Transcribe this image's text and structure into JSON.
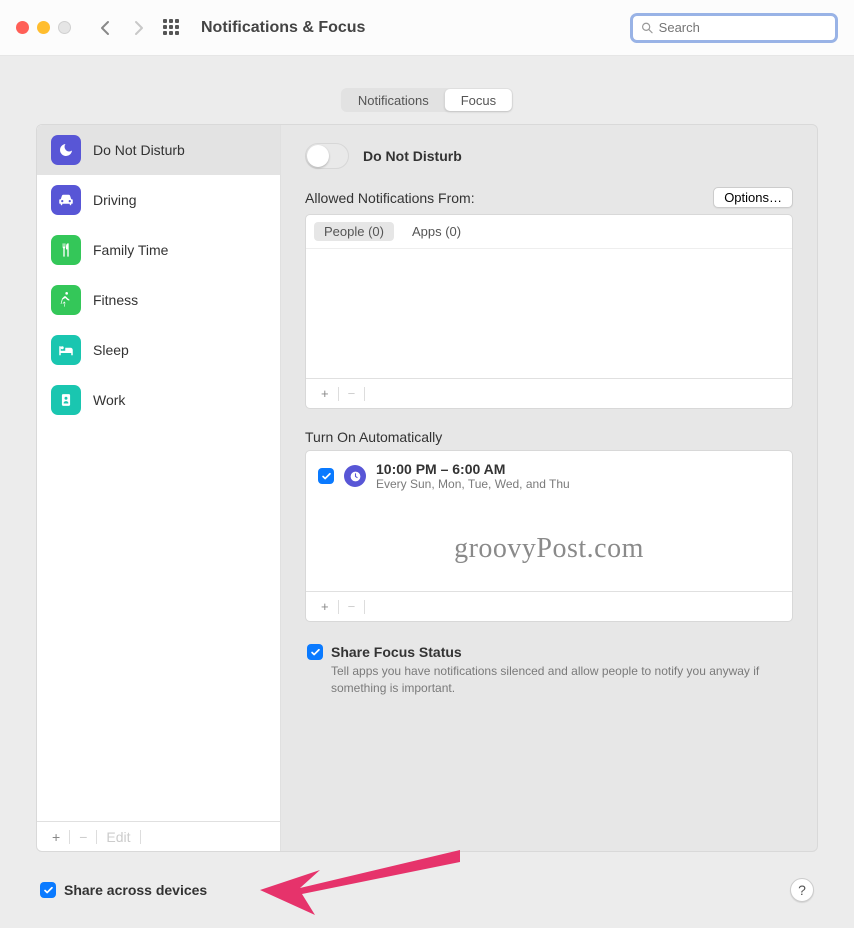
{
  "window": {
    "title": "Notifications & Focus"
  },
  "search": {
    "placeholder": "Search"
  },
  "tabs": {
    "notifications": "Notifications",
    "focus": "Focus"
  },
  "sidebar": {
    "items": [
      {
        "label": "Do Not Disturb",
        "color": "#5856d6",
        "icon": "moon"
      },
      {
        "label": "Driving",
        "color": "#5856d6",
        "icon": "car"
      },
      {
        "label": "Family Time",
        "color": "#34c759",
        "icon": "fork"
      },
      {
        "label": "Fitness",
        "color": "#34c759",
        "icon": "run"
      },
      {
        "label": "Sleep",
        "color": "#1ac6b0",
        "icon": "bed"
      },
      {
        "label": "Work",
        "color": "#1ac6b0",
        "icon": "badge"
      }
    ],
    "footer": {
      "edit": "Edit"
    }
  },
  "detail": {
    "toggle_label": "Do Not Disturb",
    "allowed_label": "Allowed Notifications From:",
    "options_label": "Options…",
    "subtabs": {
      "people": "People (0)",
      "apps": "Apps (0)"
    },
    "auto_header": "Turn On Automatically",
    "schedule": {
      "time": "10:00 PM – 6:00 AM",
      "days": "Every Sun, Mon, Tue, Wed, and Thu"
    },
    "watermark": "groovyPost.com",
    "status": {
      "label": "Share Focus Status",
      "desc": "Tell apps you have notifications silenced and allow people to notify you anyway if something is important."
    }
  },
  "footer": {
    "share_devices": "Share across devices"
  }
}
